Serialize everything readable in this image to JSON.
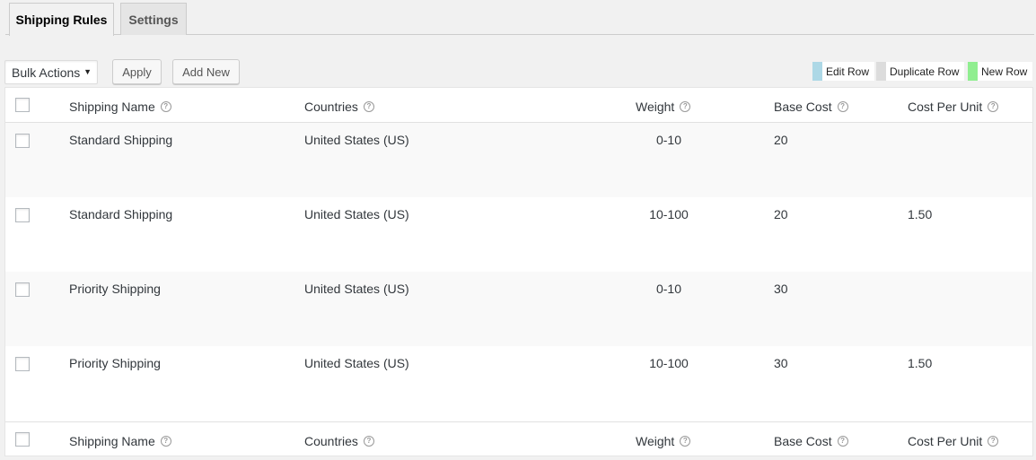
{
  "tabs": [
    {
      "label": "Shipping Rules",
      "active": true
    },
    {
      "label": "Settings",
      "active": false
    }
  ],
  "toolbar": {
    "bulk_actions": "Bulk Actions",
    "apply": "Apply",
    "add_new": "Add New"
  },
  "legend": [
    {
      "label": "Edit Row",
      "color": "#add8e6"
    },
    {
      "label": "Duplicate Row",
      "color": "#dcdcdc"
    },
    {
      "label": "New Row",
      "color": "#90ee90"
    }
  ],
  "columns": {
    "shipping_name": "Shipping Name",
    "countries": "Countries",
    "weight": "Weight",
    "base_cost": "Base Cost",
    "cost_per_unit": "Cost Per Unit"
  },
  "help_glyph": "?",
  "rows": [
    {
      "name": "Standard Shipping",
      "countries": "United States (US)",
      "weight": "0-10",
      "base_cost": "20",
      "cost_per_unit": ""
    },
    {
      "name": "Standard Shipping",
      "countries": "United States (US)",
      "weight": "10-100",
      "base_cost": "20",
      "cost_per_unit": "1.50"
    },
    {
      "name": "Priority Shipping",
      "countries": "United States (US)",
      "weight": "0-10",
      "base_cost": "30",
      "cost_per_unit": ""
    },
    {
      "name": "Priority Shipping",
      "countries": "United States (US)",
      "weight": "10-100",
      "base_cost": "30",
      "cost_per_unit": "1.50"
    }
  ]
}
